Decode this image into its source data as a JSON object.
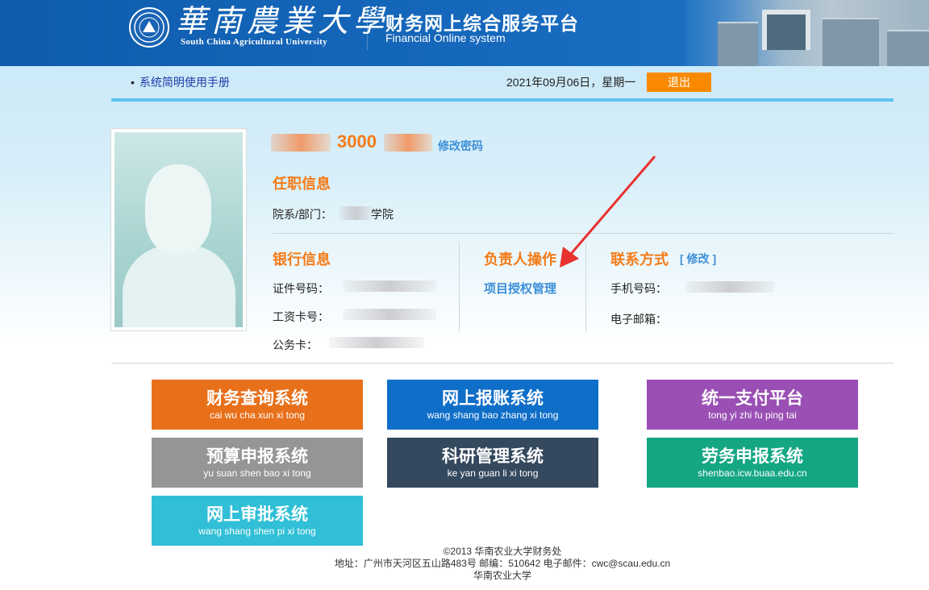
{
  "header": {
    "university_cn": "華南農業大學",
    "university_en": "South China Agricultural University",
    "system_title_cn": "财务网上综合服务平台",
    "system_title_en": "Financial Online system"
  },
  "topbar": {
    "manual_link": "系统简明使用手册",
    "date": "2021年09月06日，星期一",
    "logout_label": "退出"
  },
  "profile": {
    "user_id_visible": "3000",
    "change_password_label": "修改密码",
    "employment_title": "任职信息",
    "department_label": "院系/部门：",
    "department_value_visible": "学院"
  },
  "bank": {
    "title": "银行信息",
    "id_label": "证件号码：",
    "salary_card_label": "工资卡号：",
    "official_card_label": "公务卡："
  },
  "manager": {
    "title": "负责人操作",
    "project_auth_link": "项目授权管理"
  },
  "contact": {
    "title": "联系方式",
    "edit_label": "[ 修改 ]",
    "phone_label": "手机号码：",
    "email_label": "电子邮箱："
  },
  "tiles": [
    {
      "name": "财务查询系统",
      "pinyin": "cai wu cha xun xi tong",
      "color": "#e8701a"
    },
    {
      "name": "网上报账系统",
      "pinyin": "wang shang bao zhang xi tong",
      "color": "#0f6ec8"
    },
    {
      "name": "统一支付平台",
      "pinyin": "tong yi zhi fu ping tai",
      "color": "#9a4fb5"
    },
    {
      "name": "预算申报系统",
      "pinyin": "yu suan shen bao xi tong",
      "color": "#959595"
    },
    {
      "name": "科研管理系统",
      "pinyin": "ke yan guan li xi tong",
      "color": "#34485e"
    },
    {
      "name": "劳务申报系统",
      "pinyin": "shenbao.icw.buaa.edu.cn",
      "color": "#15a684"
    },
    {
      "name": "网上审批系统",
      "pinyin": "wang shang shen pi xi tong",
      "color": "#30bfd6"
    }
  ],
  "footer": {
    "copyright": "©2013 华南农业大学财务处",
    "address": "地址：广州市天河区五山路483号 邮编：510642 电子邮件：cwc@scau.edu.cn",
    "org": "华南农业大学"
  },
  "colors": {
    "header_blue": "#1669bd",
    "accent_orange": "#f57b17",
    "link_blue": "#3d8fd8",
    "logout_orange": "#f98a00",
    "annotation_red": "#e8322f"
  }
}
